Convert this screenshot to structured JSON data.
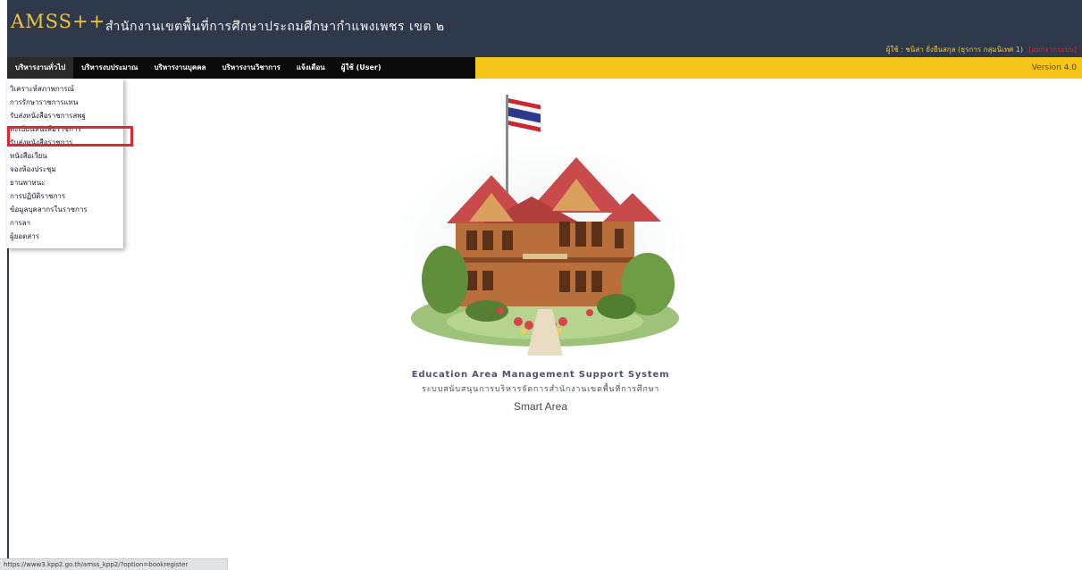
{
  "header": {
    "brand": "AMSS++",
    "org_title": "สำนักงานเขตพื้นที่การศึกษาประถมศึกษากำแพงเพชร เขต ๒",
    "user_info": "ผู้ใช้ : ชนิสา ยั่งยืนสกุล (ธุรการ กลุ่มนิเทศ 1)",
    "logout": "[ออกจากระบบ]"
  },
  "menubar": {
    "items": [
      {
        "label": "บริหารงานทั่วไป"
      },
      {
        "label": "บริหารงบประมาณ"
      },
      {
        "label": "บริหารงานบุคคล"
      },
      {
        "label": "บริหารงานวิชาการ"
      },
      {
        "label": "แจ้งเตือน"
      },
      {
        "label": "ผู้ใช้ (User)"
      }
    ],
    "version": "Version 4.0"
  },
  "dropdown": {
    "items": [
      {
        "label": "วิเคราะห์สภาพการณ์"
      },
      {
        "label": "การรักษาราชการแทน"
      },
      {
        "label": "รับส่งหนังสือราชการสพฐ"
      },
      {
        "label": "ทะเบียนหนังสือราชการ"
      },
      {
        "label": "รับส่งหนังสือราชการ"
      },
      {
        "label": "หนังสือเวียน"
      },
      {
        "label": "จองห้องประชุม"
      },
      {
        "label": "ยานพาหนะ"
      },
      {
        "label": "การปฏิบัติราชการ"
      },
      {
        "label": "ข้อมูลบุคลากรในราชการ"
      },
      {
        "label": "การลา"
      },
      {
        "label": "ผู้ยอดสาร"
      }
    ],
    "highlighted_index": 3
  },
  "hero": {
    "image": "thai-wooden-office-building-illustration"
  },
  "tagline": {
    "english": "Education Area Management Support System",
    "thai": "ระบบสนับสนุนการบริหารจัดการสำนักงานเขตพื้นที่การศึกษา",
    "subtitle": "Smart Area"
  },
  "status_bar": {
    "url": "https://www3.kpp2.go.th/amss_kpp2/?option=bookregister"
  },
  "colors": {
    "header_bg": "#2e3a4b",
    "brand": "#f0c33c",
    "menubar_bg": "#0a0a0a",
    "menubar_accent": "#f5c518",
    "highlight": "#e3262d"
  }
}
